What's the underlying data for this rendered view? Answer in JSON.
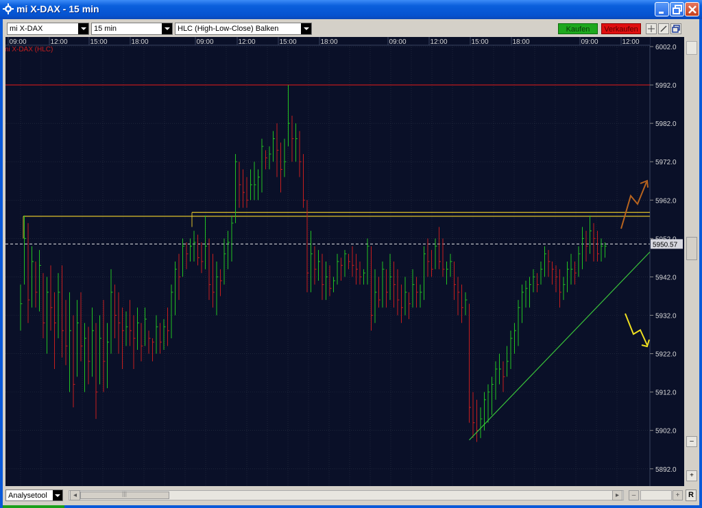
{
  "window": {
    "title": "mi X-DAX - 15 min"
  },
  "toolbar": {
    "instrument": "mi X-DAX",
    "interval": "15 min",
    "chart_style": "HLC (High-Low-Close) Balken",
    "buy_label": "Kaufen",
    "sell_label": "Verkaufen"
  },
  "bottombar": {
    "tool_select": "Analysetool",
    "reset_label": "R"
  },
  "colors": {
    "background": "#0a1028",
    "grid": "#2a3346",
    "up_bar": "#22c422",
    "down_bar": "#c81e1e",
    "resistance_red": "#d21a1a",
    "resistance_yellow": "#e0c22a",
    "trendline": "#3ac43a",
    "arrow_up": "#b8641e",
    "arrow_down": "#f0e020"
  },
  "chart_data": {
    "type": "hlc_bar",
    "title": "mi X-DAX (HLC)",
    "x_tick_labels": [
      "09:00",
      "12:00",
      "15:00",
      "18:00",
      "09:00",
      "12:00",
      "15:00",
      "18:00",
      "09:00",
      "12:00",
      "15:00",
      "18:00",
      "09:00",
      "12:00"
    ],
    "y_tick_labels": [
      "6002.0",
      "5992.0",
      "5982.0",
      "5972.0",
      "5962.0",
      "5952.0",
      "5942.0",
      "5932.0",
      "5922.0",
      "5912.0",
      "5902.0",
      "5892.0"
    ],
    "ylim": [
      5887.5,
      6004.5
    ],
    "last_price": 5950.57,
    "last_price_label": "5950.57",
    "horizontal_lines": [
      {
        "value": 5992.0,
        "color": "red"
      },
      {
        "value": 5958.8,
        "color": "yellow"
      },
      {
        "value": 5957.8,
        "color": "yellow"
      }
    ],
    "trendline": {
      "from_index": 119,
      "from_value": 5899.5,
      "to_index": 157,
      "to_value": 5948.5
    },
    "bars": [
      [
        5940,
        5928,
        5935
      ],
      [
        5958,
        5940,
        5952
      ],
      [
        5956,
        5930,
        5936
      ],
      [
        5950,
        5934,
        5946
      ],
      [
        5946,
        5934,
        5938
      ],
      [
        5949,
        5933,
        5945
      ],
      [
        5943,
        5926,
        5930
      ],
      [
        5942,
        5922,
        5938
      ],
      [
        5945,
        5928,
        5934
      ],
      [
        5938,
        5918,
        5930
      ],
      [
        5943,
        5926,
        5938
      ],
      [
        5945,
        5921,
        5928
      ],
      [
        5936,
        5919,
        5924
      ],
      [
        5938,
        5912,
        5928
      ],
      [
        5932,
        5908,
        5914
      ],
      [
        5936,
        5916,
        5930
      ],
      [
        5938,
        5920,
        5924
      ],
      [
        5930,
        5912,
        5926
      ],
      [
        5929,
        5914,
        5920
      ],
      [
        5934,
        5916,
        5928
      ],
      [
        5930,
        5905,
        5912
      ],
      [
        5932,
        5914,
        5926
      ],
      [
        5936,
        5912,
        5920
      ],
      [
        5930,
        5913,
        5925
      ],
      [
        5944,
        5922,
        5938
      ],
      [
        5940,
        5926,
        5932
      ],
      [
        5938,
        5922,
        5930
      ],
      [
        5934,
        5918,
        5928
      ],
      [
        5933,
        5924,
        5929
      ],
      [
        5936,
        5924,
        5928
      ],
      [
        5932,
        5918,
        5926
      ],
      [
        5934,
        5923,
        5930
      ],
      [
        5930,
        5920,
        5924
      ],
      [
        5934,
        5924,
        5931
      ],
      [
        5928,
        5922,
        5926
      ],
      [
        5926,
        5920,
        5925
      ],
      [
        5932,
        5922,
        5929
      ],
      [
        5930,
        5922,
        5925
      ],
      [
        5931,
        5923,
        5929
      ],
      [
        5934,
        5924,
        5928
      ],
      [
        5940,
        5926,
        5938
      ],
      [
        5946,
        5932,
        5944
      ],
      [
        5948,
        5936,
        5942
      ],
      [
        5952,
        5942,
        5950
      ],
      [
        5951,
        5944,
        5948
      ],
      [
        5952,
        5946,
        5950
      ],
      [
        5954,
        5946,
        5951
      ],
      [
        5953,
        5945,
        5947
      ],
      [
        5951,
        5943,
        5946
      ],
      [
        5958,
        5944,
        5950
      ],
      [
        5952,
        5936,
        5940
      ],
      [
        5948,
        5934,
        5938
      ],
      [
        5946,
        5932,
        5942
      ],
      [
        5944,
        5937,
        5941
      ],
      [
        5952,
        5940,
        5948
      ],
      [
        5954,
        5944,
        5951
      ],
      [
        5958,
        5946,
        5956
      ],
      [
        5974,
        5956,
        5972
      ],
      [
        5972,
        5960,
        5966
      ],
      [
        5970,
        5960,
        5964
      ],
      [
        5968,
        5960,
        5962
      ],
      [
        5970,
        5962,
        5966
      ],
      [
        5972,
        5962,
        5966
      ],
      [
        5970,
        5962,
        5968
      ],
      [
        5978,
        5964,
        5976
      ],
      [
        5975,
        5970,
        5973
      ],
      [
        5976,
        5970,
        5974
      ],
      [
        5980,
        5972,
        5978
      ],
      [
        5982,
        5968,
        5975
      ],
      [
        5977,
        5964,
        5970
      ],
      [
        5978,
        5968,
        5972
      ],
      [
        5992,
        5976,
        5982
      ],
      [
        5984,
        5972,
        5978
      ],
      [
        5982,
        5972,
        5978
      ],
      [
        5980,
        5968,
        5972
      ],
      [
        5974,
        5960,
        5962
      ],
      [
        5962,
        5938,
        5943
      ],
      [
        5954,
        5938,
        5948
      ],
      [
        5950,
        5940,
        5944
      ],
      [
        5949,
        5941,
        5946
      ],
      [
        5948,
        5936,
        5940
      ],
      [
        5946,
        5936,
        5942
      ],
      [
        5945,
        5937,
        5939
      ],
      [
        5942,
        5938,
        5941
      ],
      [
        5948,
        5940,
        5946
      ],
      [
        5947,
        5941,
        5945
      ],
      [
        5949,
        5942,
        5948
      ],
      [
        5948,
        5944,
        5946
      ],
      [
        5950,
        5942,
        5945
      ],
      [
        5948,
        5940,
        5944
      ],
      [
        5946,
        5940,
        5942
      ],
      [
        5944,
        5940,
        5943
      ],
      [
        5952,
        5940,
        5950
      ],
      [
        5950,
        5928,
        5932
      ],
      [
        5944,
        5930,
        5938
      ],
      [
        5942,
        5934,
        5936
      ],
      [
        5946,
        5934,
        5944
      ],
      [
        5944,
        5934,
        5938
      ],
      [
        5948,
        5936,
        5942
      ],
      [
        5946,
        5934,
        5940
      ],
      [
        5944,
        5932,
        5936
      ],
      [
        5940,
        5930,
        5934
      ],
      [
        5942,
        5932,
        5938
      ],
      [
        5938,
        5931,
        5935
      ],
      [
        5944,
        5934,
        5940
      ],
      [
        5942,
        5934,
        5938
      ],
      [
        5940,
        5934,
        5938
      ],
      [
        5950,
        5936,
        5948
      ],
      [
        5952,
        5942,
        5946
      ],
      [
        5949,
        5942,
        5944
      ],
      [
        5952,
        5944,
        5950
      ],
      [
        5955,
        5944,
        5946
      ],
      [
        5952,
        5942,
        5944
      ],
      [
        5946,
        5940,
        5944
      ],
      [
        5948,
        5942,
        5946
      ],
      [
        5946,
        5936,
        5940
      ],
      [
        5942,
        5932,
        5938
      ],
      [
        5940,
        5930,
        5934
      ],
      [
        5938,
        5932,
        5936
      ],
      [
        5935,
        5904,
        5908
      ],
      [
        5912,
        5900,
        5904
      ],
      [
        5910,
        5899,
        5902
      ],
      [
        5908,
        5900,
        5905
      ],
      [
        5912,
        5902,
        5910
      ],
      [
        5914,
        5904,
        5912
      ],
      [
        5916,
        5906,
        5914
      ],
      [
        5920,
        5910,
        5918
      ],
      [
        5922,
        5914,
        5918
      ],
      [
        5920,
        5912,
        5916
      ],
      [
        5924,
        5916,
        5920
      ],
      [
        5928,
        5918,
        5926
      ],
      [
        5930,
        5922,
        5928
      ],
      [
        5936,
        5924,
        5934
      ],
      [
        5940,
        5930,
        5938
      ],
      [
        5941,
        5934,
        5939
      ],
      [
        5942,
        5934,
        5940
      ],
      [
        5944,
        5938,
        5942
      ],
      [
        5943,
        5938,
        5940
      ],
      [
        5946,
        5940,
        5944
      ],
      [
        5950,
        5942,
        5948
      ],
      [
        5949,
        5942,
        5946
      ],
      [
        5946,
        5940,
        5944
      ],
      [
        5945,
        5938,
        5942
      ],
      [
        5944,
        5934,
        5938
      ],
      [
        5942,
        5936,
        5940
      ],
      [
        5946,
        5938,
        5944
      ],
      [
        5948,
        5940,
        5944
      ],
      [
        5946,
        5940,
        5943
      ],
      [
        5950,
        5942,
        5948
      ],
      [
        5955,
        5944,
        5952
      ],
      [
        5954,
        5946,
        5950
      ],
      [
        5958,
        5948,
        5954
      ],
      [
        5956,
        5946,
        5952
      ],
      [
        5954,
        5946,
        5948
      ],
      [
        5952,
        5946,
        5950
      ],
      [
        5951,
        5947,
        5950
      ]
    ]
  }
}
